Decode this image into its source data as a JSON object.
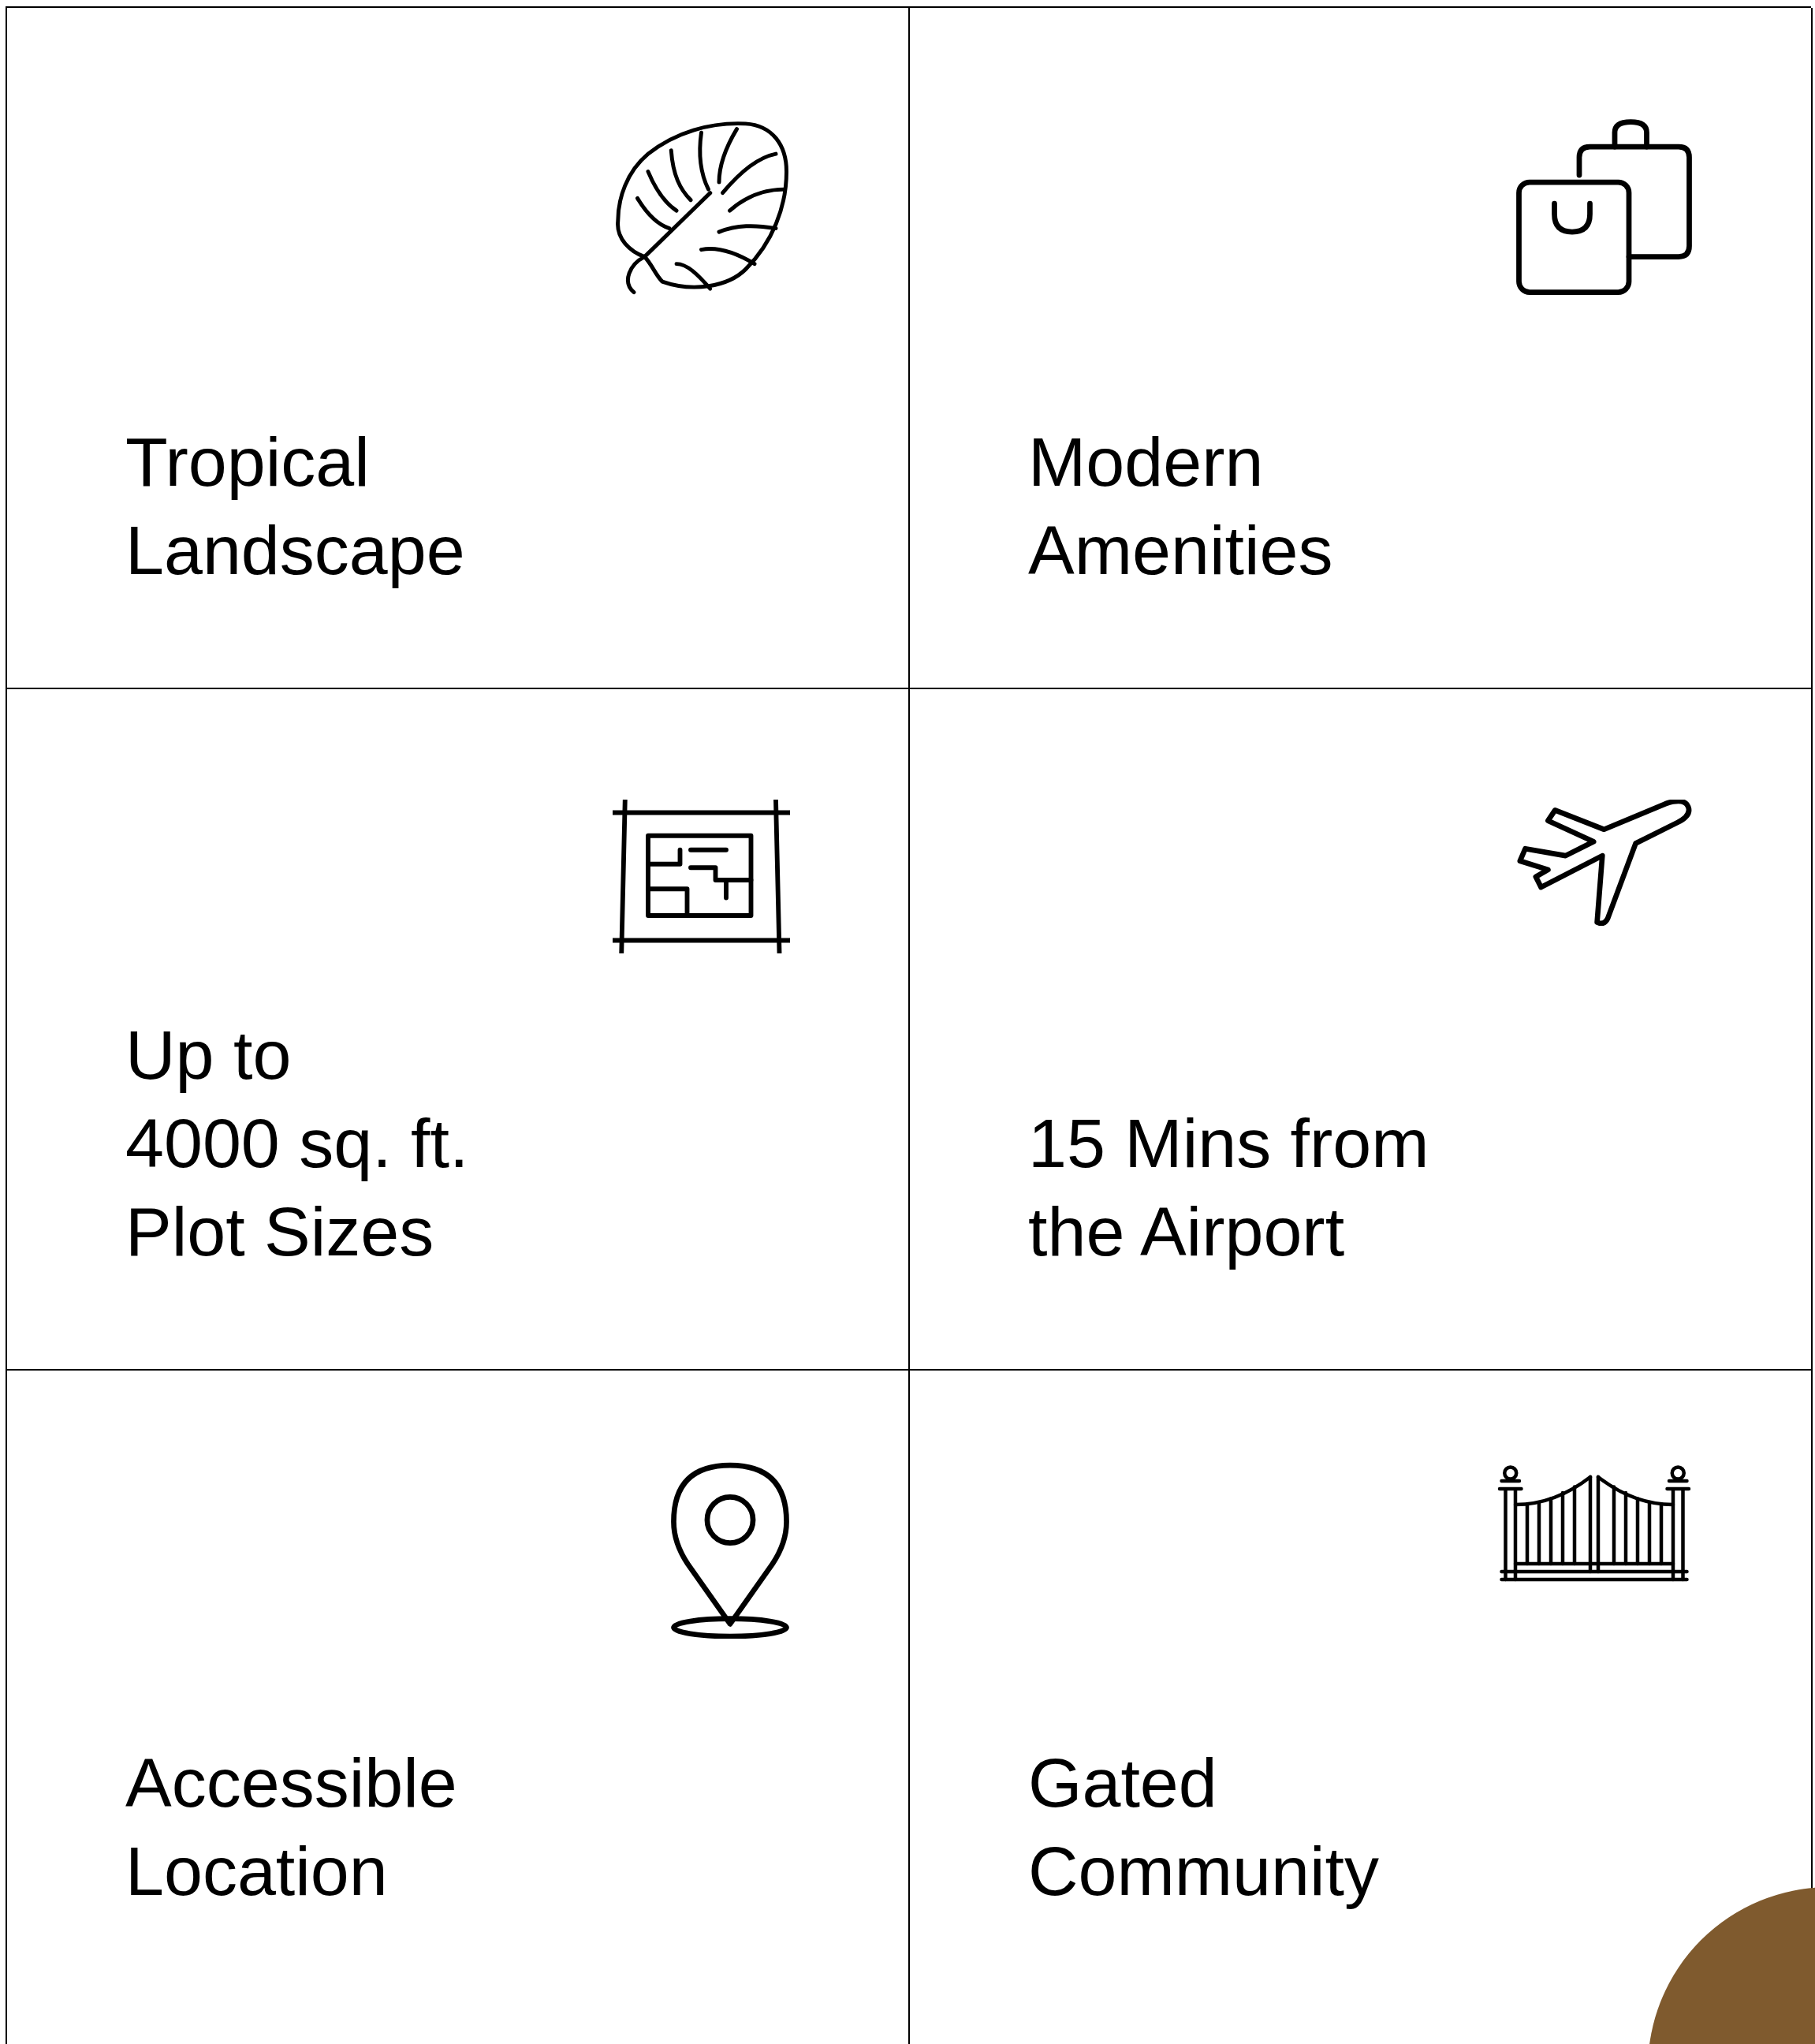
{
  "features": [
    {
      "label": "Tropical\nLandscape"
    },
    {
      "label": "Modern\nAmenities"
    },
    {
      "label": "Up to\n4000 sq. ft.\nPlot Sizes"
    },
    {
      "label": "15 Mins from\nthe Airport"
    },
    {
      "label": "Accessible\nLocation"
    },
    {
      "label": "Gated\nCommunity"
    }
  ]
}
